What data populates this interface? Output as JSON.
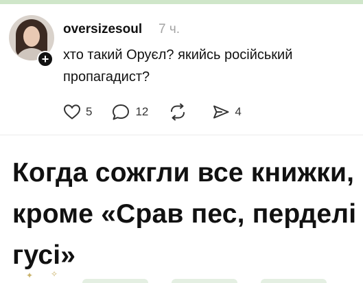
{
  "post": {
    "username": "oversizesoul",
    "time": "7 ч.",
    "text": "хто такий Оруєл? якийсь російський пропагадист?",
    "follow_symbol": "+",
    "actions": {
      "likes": "5",
      "comments": "12",
      "repost": "",
      "shares": "4"
    },
    "icons": {
      "like": "heart-icon",
      "comment": "comment-icon",
      "repost": "repost-icon",
      "share": "share-icon"
    }
  },
  "caption": {
    "text": "Когда сожгли все книжки, кроме «Срав пес, перделі гусі»"
  }
}
